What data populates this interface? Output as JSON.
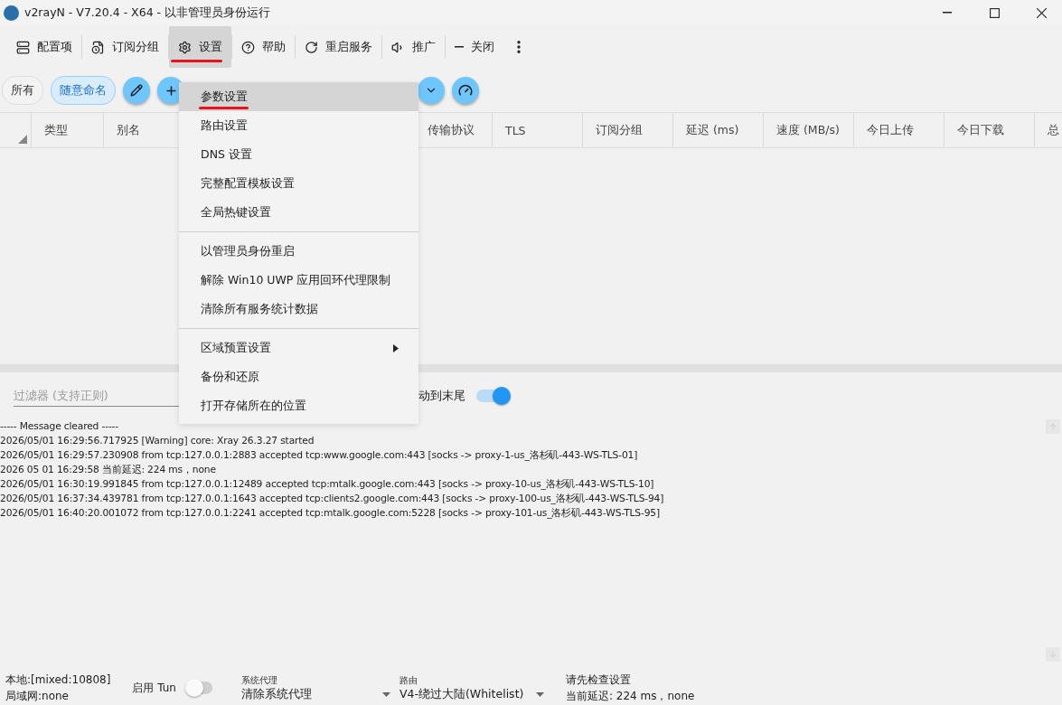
{
  "window": {
    "title": "v2rayN - V7.20.4 - X64 - 以非管理员身份运行"
  },
  "toolbar": [
    {
      "kind": "servers",
      "label": "配置项",
      "selected": false,
      "annotated": false
    },
    {
      "kind": "subscription",
      "label": "订阅分组",
      "selected": false,
      "annotated": false
    },
    {
      "kind": "settings",
      "label": "设置",
      "selected": true,
      "annotated": true
    },
    {
      "kind": "help",
      "label": "帮助",
      "selected": false,
      "annotated": false
    },
    {
      "kind": "restart",
      "label": "重启服务",
      "selected": false,
      "annotated": false
    },
    {
      "kind": "promote",
      "label": "推广",
      "selected": false,
      "annotated": false
    },
    {
      "kind": "close",
      "label": "关闭",
      "selected": false,
      "annotated": false
    }
  ],
  "groups": [
    {
      "label": "所有",
      "selected": false
    },
    {
      "label": "随意命名",
      "selected": true
    }
  ],
  "table": {
    "columns": [
      "类型",
      "别名",
      "传输协议",
      "TLS",
      "订阅分组",
      "延迟 (ms)",
      "速度 (MB/s)",
      "今日上传",
      "今日下载",
      "总"
    ]
  },
  "menu": {
    "items": [
      {
        "kind": "item",
        "label": "参数设置",
        "selected": true,
        "annotated": true
      },
      {
        "kind": "item",
        "label": "路由设置",
        "selected": false,
        "annotated": false
      },
      {
        "kind": "item",
        "label": "DNS 设置",
        "selected": false,
        "annotated": false
      },
      {
        "kind": "item",
        "label": "完整配置模板设置",
        "selected": false,
        "annotated": false
      },
      {
        "kind": "item",
        "label": "全局热键设置",
        "selected": false,
        "annotated": false
      },
      {
        "kind": "separator"
      },
      {
        "kind": "item",
        "label": "以管理员身份重启",
        "selected": false,
        "annotated": false
      },
      {
        "kind": "item",
        "label": "解除 Win10 UWP 应用回环代理限制",
        "selected": false,
        "annotated": false
      },
      {
        "kind": "item",
        "label": "清除所有服务统计数据",
        "selected": false,
        "annotated": false
      },
      {
        "kind": "separator"
      },
      {
        "kind": "submenu",
        "label": "区域预置设置",
        "selected": false,
        "annotated": false
      },
      {
        "kind": "item",
        "label": "备份和还原",
        "selected": false,
        "annotated": false
      },
      {
        "kind": "item",
        "label": "打开存储所在的位置",
        "selected": false,
        "annotated": false
      }
    ]
  },
  "log": {
    "filter_placeholder": "过滤器 (支持正则)",
    "autoscroll_label": "动到末尾",
    "autoscroll_on": true,
    "lines": [
      "----- Message cleared -----",
      "2026/05/01 16:29:56.717925 [Warning] core: Xray 26.3.27 started",
      "2026/05/01 16:29:57.230908 from tcp:127.0.0.1:2883 accepted tcp:www.google.com:443 [socks -> proxy-1-us_洛杉矶-443-WS-TLS-01]",
      "2026 05 01 16:29:58 当前延迟: 224 ms，none",
      "2026/05/01 16:30:19.991845 from tcp:127.0.0.1:12489 accepted tcp:mtalk.google.com:443 [socks -> proxy-10-us_洛杉矶-443-WS-TLS-10]",
      "2026/05/01 16:37:34.439781 from tcp:127.0.0.1:1643 accepted tcp:clients2.google.com:443 [socks -> proxy-100-us_洛杉矶-443-WS-TLS-94]",
      "2026/05/01 16:40:20.001072 from tcp:127.0.0.1:2241 accepted tcp:mtalk.google.com:5228 [socks -> proxy-101-us_洛杉矶-443-WS-TLS-95]"
    ]
  },
  "status_bar": {
    "local": "本地:[mixed:10808]",
    "lan": "局域网:none",
    "tun_label": "启用 Tun",
    "tun_on": false,
    "system_proxy": {
      "caption": "系统代理",
      "value": "清除系统代理"
    },
    "routing": {
      "caption": "路由",
      "value": "V4-绕过大陆(Whitelist)"
    },
    "notice": "请先检查设置",
    "latency": "当前延迟: 224 ms，none"
  }
}
